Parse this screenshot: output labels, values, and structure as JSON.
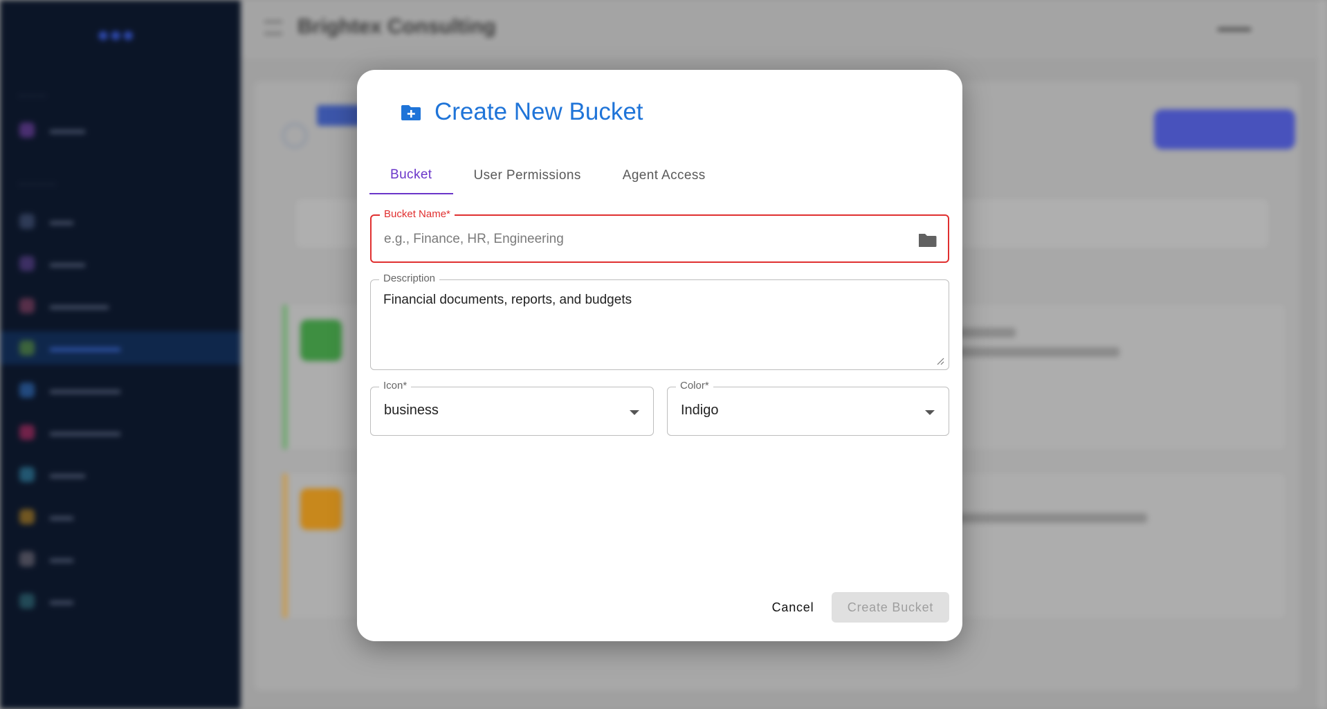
{
  "background": {
    "topbar_title": "Brightex Consulting",
    "colors": {
      "sidebar": "#0e1a30",
      "accent": "#3a5bd9"
    }
  },
  "modal": {
    "title": "Create New Bucket",
    "title_icon": "create-folder-icon",
    "tabs": [
      {
        "label": "Bucket",
        "active": true
      },
      {
        "label": "User Permissions",
        "active": false
      },
      {
        "label": "Agent Access",
        "active": false
      }
    ],
    "bucket_name": {
      "label": "Bucket Name*",
      "value": "",
      "placeholder": "e.g., Finance, HR, Engineering",
      "icon": "folder-icon"
    },
    "description": {
      "label": "Description",
      "value": "Financial documents, reports, and budgets"
    },
    "icon_select": {
      "label": "Icon*",
      "value": "business"
    },
    "color_select": {
      "label": "Color*",
      "value": "Indigo"
    },
    "actions": {
      "cancel": "Cancel",
      "create": "Create Bucket"
    },
    "colors": {
      "title": "#1f74d8",
      "tab_active": "#6a35c9",
      "error": "#e02f2f"
    }
  }
}
